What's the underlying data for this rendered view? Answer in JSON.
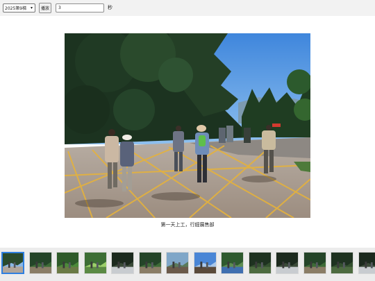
{
  "toolbar": {
    "album_select": {
      "selected": "2025第9梯",
      "options": [
        "2025第9梯"
      ]
    },
    "play_label": "播放",
    "interval_value": "3",
    "unit_label": "秒"
  },
  "viewer": {
    "caption": "第一天上工，行經展售部"
  },
  "filmstrip": {
    "active_index": 0,
    "thumbnails": [
      {
        "name": "thumbnail-1",
        "scene": "road-group"
      },
      {
        "name": "thumbnail-2",
        "scene": "forest-group"
      },
      {
        "name": "thumbnail-3",
        "scene": "green-slope"
      },
      {
        "name": "thumbnail-4",
        "scene": "bright-trees"
      },
      {
        "name": "thumbnail-5",
        "scene": "dark-forest"
      },
      {
        "name": "thumbnail-6",
        "scene": "forest-group"
      },
      {
        "name": "thumbnail-7",
        "scene": "mountain-view"
      },
      {
        "name": "thumbnail-8",
        "scene": "sky-person"
      },
      {
        "name": "thumbnail-9",
        "scene": "group-green"
      },
      {
        "name": "thumbnail-10",
        "scene": "dense-forest"
      },
      {
        "name": "thumbnail-11",
        "scene": "dark-forest"
      },
      {
        "name": "thumbnail-12",
        "scene": "forest-group"
      },
      {
        "name": "thumbnail-13",
        "scene": "dense-forest"
      },
      {
        "name": "thumbnail-14",
        "scene": "dark-forest"
      }
    ]
  },
  "colors": {
    "active_border": "#2f7fe0",
    "sky": "#5b9be0",
    "pavement": "#b9a89a",
    "road_lines": "#e6b43a",
    "foliage": "#1f3a22"
  }
}
